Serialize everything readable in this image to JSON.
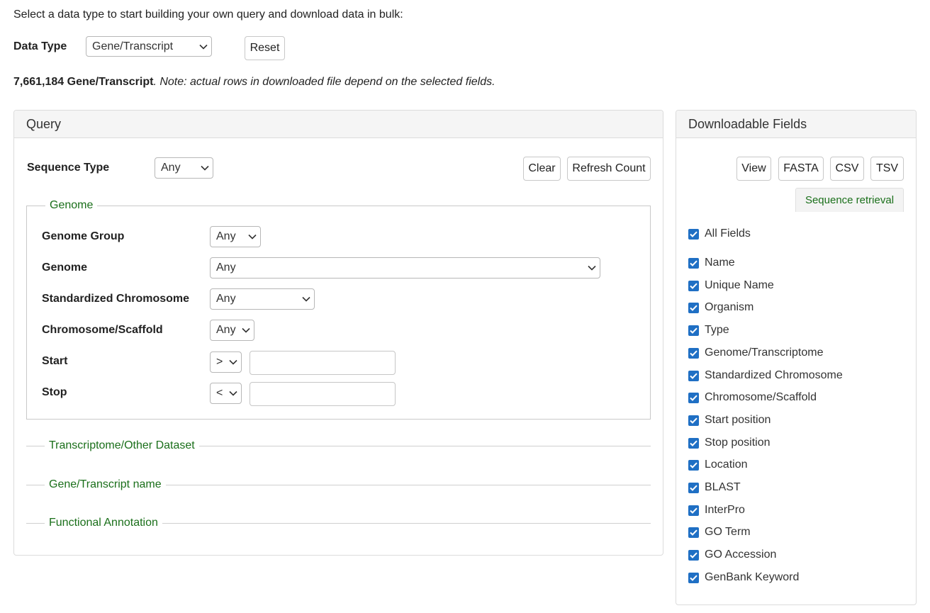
{
  "intro": "Select a data type to start building your own query and download data in bulk:",
  "data_type": {
    "label": "Data Type",
    "value": "Gene/Transcript",
    "reset": "Reset"
  },
  "count": {
    "number_text": "7,661,184 Gene/Transcript",
    "note": ". Note: actual rows in downloaded file depend on the selected fields."
  },
  "query": {
    "title": "Query",
    "sequence_type": {
      "label": "Sequence Type",
      "value": "Any"
    },
    "clear": "Clear",
    "refresh": "Refresh Count",
    "genome": {
      "legend": "Genome",
      "group": {
        "label": "Genome Group",
        "value": "Any"
      },
      "genome": {
        "label": "Genome",
        "value": "Any"
      },
      "std_chrom": {
        "label": "Standardized Chromosome",
        "value": "Any"
      },
      "chrom_scaffold": {
        "label": "Chromosome/Scaffold",
        "value": "Any"
      },
      "start": {
        "label": "Start",
        "op": ">",
        "value": ""
      },
      "stop": {
        "label": "Stop",
        "op": "<",
        "value": ""
      }
    },
    "sections": {
      "transcriptome": "Transcriptome/Other Dataset",
      "gene_name": "Gene/Transcript name",
      "functional": "Functional Annotation"
    }
  },
  "fields": {
    "title": "Downloadable Fields",
    "buttons": {
      "view": "View",
      "fasta": "FASTA",
      "csv": "CSV",
      "tsv": "TSV"
    },
    "seq_tab": "Sequence retrieval",
    "all": "All Fields",
    "items": [
      "Name",
      "Unique Name",
      "Organism",
      "Type",
      "Genome/Transcriptome",
      "Standardized Chromosome",
      "Chromosome/Scaffold",
      "Start position",
      "Stop position",
      "Location",
      "BLAST",
      "InterPro",
      "GO Term",
      "GO Accession",
      "GenBank Keyword"
    ]
  },
  "colors": {
    "accent_green": "#1a6f1a",
    "checkbox_blue": "#1f6fc4"
  },
  "icons": {
    "dropdown": "chevron-down-icon",
    "check": "check-icon"
  }
}
